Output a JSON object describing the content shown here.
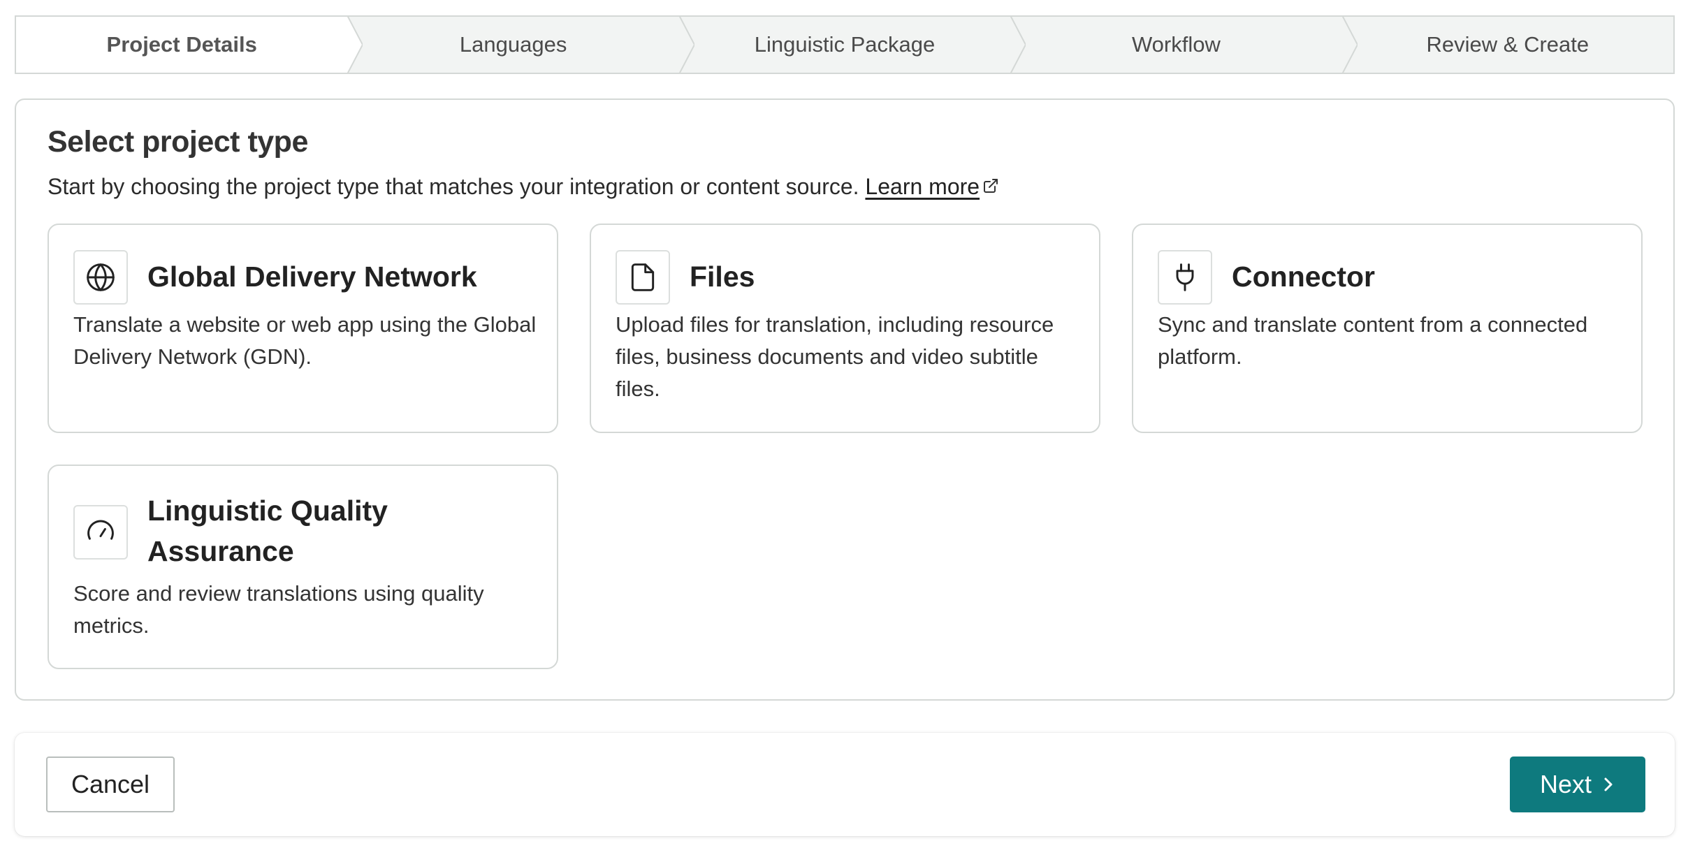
{
  "stepper": {
    "steps": [
      {
        "label": "Project Details",
        "active": true
      },
      {
        "label": "Languages",
        "active": false
      },
      {
        "label": "Linguistic Package",
        "active": false
      },
      {
        "label": "Workflow",
        "active": false
      },
      {
        "label": "Review & Create",
        "active": false
      }
    ]
  },
  "panel": {
    "title": "Select project type",
    "description": "Start by choosing the project type that matches your integration or content source.",
    "learn_more": "Learn more",
    "cards": [
      {
        "title": "Global Delivery Network",
        "description": "Translate a website or web app using the Global Delivery Network (GDN).",
        "icon": "globe-icon"
      },
      {
        "title": "Files",
        "description": "Upload files for translation, including resource files, business documents and video subtitle files.",
        "icon": "file-icon"
      },
      {
        "title": "Connector",
        "description": "Sync and translate content from a connected platform.",
        "icon": "plug-icon"
      },
      {
        "title": "Linguistic Quality Assurance",
        "description": "Score and review translations using quality metrics.",
        "icon": "gauge-icon"
      }
    ]
  },
  "footer": {
    "cancel_label": "Cancel",
    "next_label": "Next"
  },
  "colors": {
    "accent": "#0e7a7e",
    "border": "#d4d8d6",
    "stepper_bg": "#f2f4f3"
  }
}
